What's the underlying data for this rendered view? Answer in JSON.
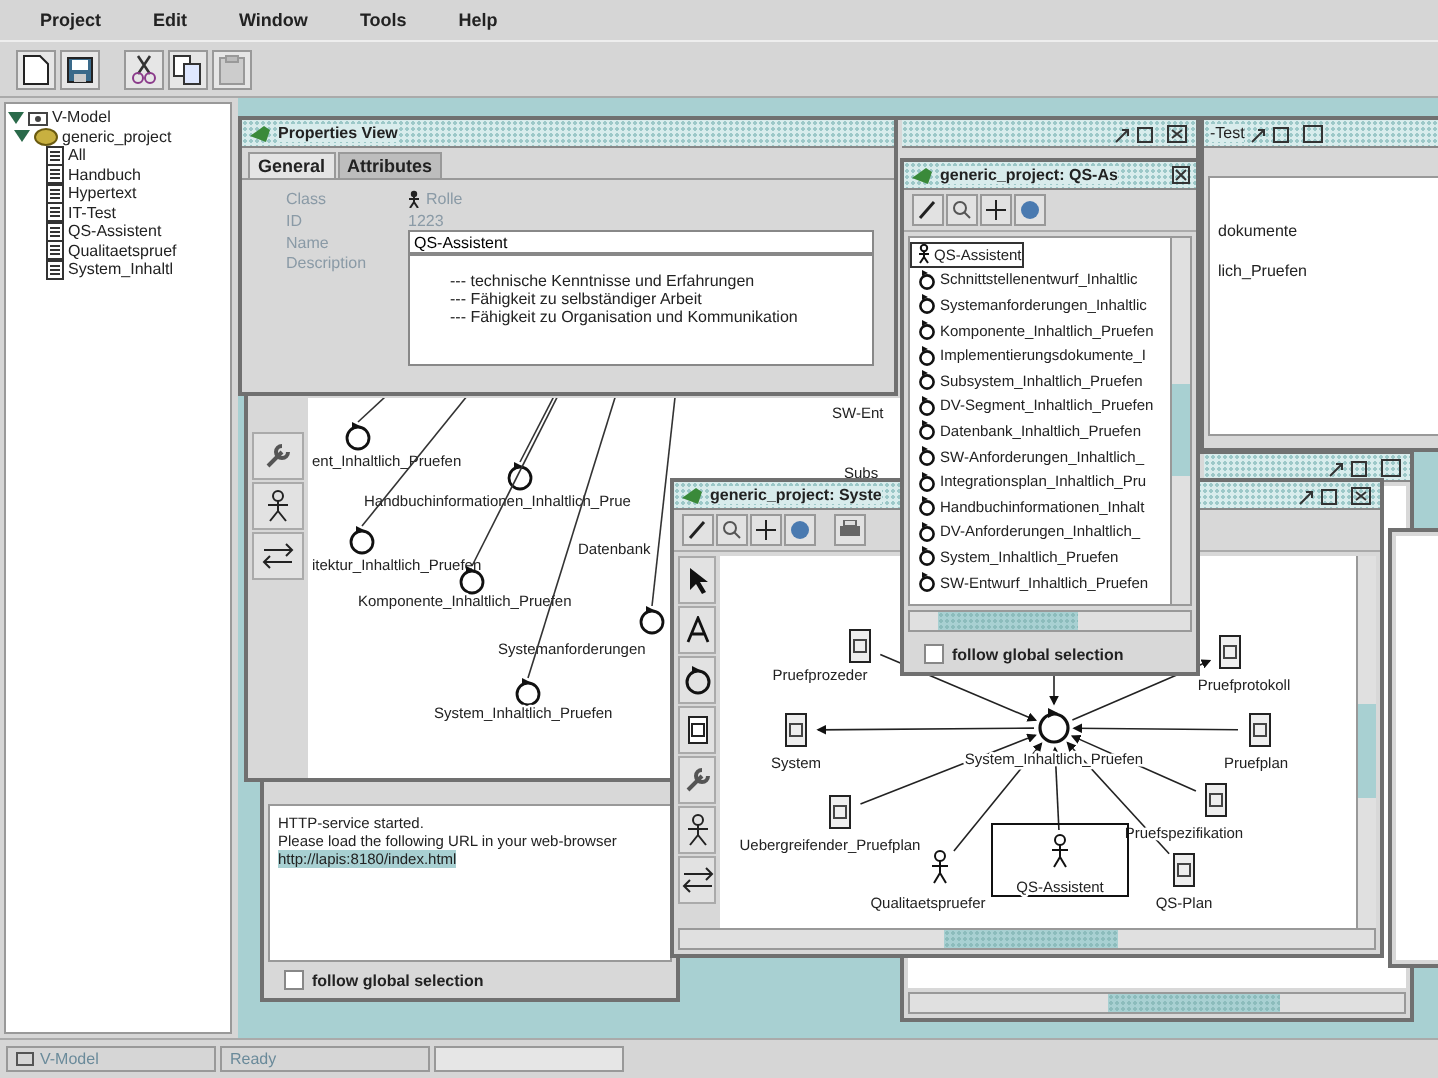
{
  "menu": [
    {
      "label": "Project"
    },
    {
      "label": "Edit"
    },
    {
      "label": "Window"
    },
    {
      "label": "Tools"
    },
    {
      "label": "Help"
    }
  ],
  "tree": {
    "label": "V-Model",
    "expanded": true,
    "children": [
      {
        "label": "generic_project",
        "expanded": true,
        "children": [
          {
            "label": "All"
          },
          {
            "label": "Handbuch"
          },
          {
            "label": "Hypertext"
          },
          {
            "label": "IT-Test"
          },
          {
            "label": "QS-Assistent"
          },
          {
            "label": "Qualitaetspruef"
          },
          {
            "label": "System_Inhaltl"
          }
        ]
      }
    ]
  },
  "properties": {
    "title": "Properties View",
    "tabs": [
      {
        "label": "General",
        "selected": true
      },
      {
        "label": "Attributes",
        "selected": false
      }
    ],
    "fields": [
      {
        "label": "Class",
        "value": "Rolle"
      },
      {
        "label": "ID",
        "value": "1223"
      }
    ],
    "name": {
      "label": "Name",
      "value": "QS-Assistent"
    },
    "description": {
      "label": "Description",
      "lines": [
        "--- technische Kenntnisse und Erfahrungen",
        "--- Fähigkeit zu selbständiger Arbeit",
        "--- Fähigkeit zu Organisation und Kommunikation"
      ]
    }
  },
  "background_diagram": {
    "nodes": [
      {
        "kind": "activity",
        "label": "ent_Inhaltlich_Pruefen"
      },
      {
        "kind": "activity",
        "label": "Handbuchinformationen_Inhaltlich_Prue"
      },
      {
        "kind": "activity",
        "label": "itektur_Inhaltlich_Pruefen"
      },
      {
        "kind": "activity",
        "label": "Komponente_Inhaltlich_Pruefen"
      },
      {
        "kind": "text",
        "label": "Datenbank"
      },
      {
        "kind": "activity",
        "label": "Systemanforderungen"
      },
      {
        "kind": "activity",
        "label": "System_Inhaltlich_Pruefen"
      },
      {
        "kind": "text",
        "label": "SW-Ent"
      },
      {
        "kind": "text",
        "label": "Subs"
      }
    ]
  },
  "test_window": {
    "title": "-Test",
    "items": [
      "dokumente",
      "lich_Pruefen"
    ]
  },
  "list_window": {
    "title": "generic_project: QS-As",
    "checkbox_label": "follow global selection",
    "follow_global_selection": false,
    "items": [
      {
        "kind": "role",
        "label": "QS-Assistent",
        "selected": true
      },
      {
        "kind": "activity",
        "label": "Schnittstellenentwurf_Inhaltlic",
        "selected": false
      },
      {
        "kind": "activity",
        "label": "Systemanforderungen_Inhaltlic",
        "selected": false
      },
      {
        "kind": "activity",
        "label": "Komponente_Inhaltlich_Pruefen",
        "selected": false
      },
      {
        "kind": "activity",
        "label": "Implementierungsdokumente_I",
        "selected": false
      },
      {
        "kind": "activity",
        "label": "Subsystem_Inhaltlich_Pruefen",
        "selected": false
      },
      {
        "kind": "activity",
        "label": "DV-Segment_Inhaltlich_Pruefen",
        "selected": false
      },
      {
        "kind": "activity",
        "label": "Datenbank_Inhaltlich_Pruefen",
        "selected": false
      },
      {
        "kind": "activity",
        "label": "SW-Anforderungen_Inhaltlich_",
        "selected": false
      },
      {
        "kind": "activity",
        "label": "Integrationsplan_Inhaltlich_Pru",
        "selected": false
      },
      {
        "kind": "activity",
        "label": "Handbuchinformationen_Inhalt",
        "selected": false
      },
      {
        "kind": "activity",
        "label": "DV-Anforderungen_Inhaltlich_",
        "selected": false
      },
      {
        "kind": "activity",
        "label": "System_Inhaltlich_Pruefen",
        "selected": false
      },
      {
        "kind": "activity",
        "label": "SW-Entwurf_Inhaltlich_Pruefen",
        "selected": false
      }
    ]
  },
  "diagram_window": {
    "title": "generic_project: Syste",
    "nodes": [
      {
        "kind": "activity",
        "label": "System_Inhaltlich_Pruefen",
        "selected": false
      },
      {
        "kind": "product",
        "label": "Pruefprozeder",
        "selected": false
      },
      {
        "kind": "product",
        "label": "System",
        "selected": false
      },
      {
        "kind": "product",
        "label": "Pruefprotokoll",
        "selected": false
      },
      {
        "kind": "product",
        "label": "Pruefplan",
        "selected": false
      },
      {
        "kind": "product",
        "label": "Pruefspezifikation",
        "selected": false
      },
      {
        "kind": "product",
        "label": "Uebergreifender_Pruefplan",
        "selected": false
      },
      {
        "kind": "role",
        "label": "Qualitaetspruefer",
        "selected": false
      },
      {
        "kind": "role",
        "label": "QS-Assistent",
        "selected": true
      },
      {
        "kind": "product",
        "label": "QS-Plan",
        "selected": false
      }
    ]
  },
  "output_window": {
    "lines": [
      "HTTP-service started.",
      "Please load the following URL in your web-browser"
    ],
    "link": "http://lapis:8180/index.html",
    "checkbox_label": "follow global selection",
    "follow_global_selection": false
  },
  "status_bar": [
    "V-Model",
    "Ready"
  ]
}
